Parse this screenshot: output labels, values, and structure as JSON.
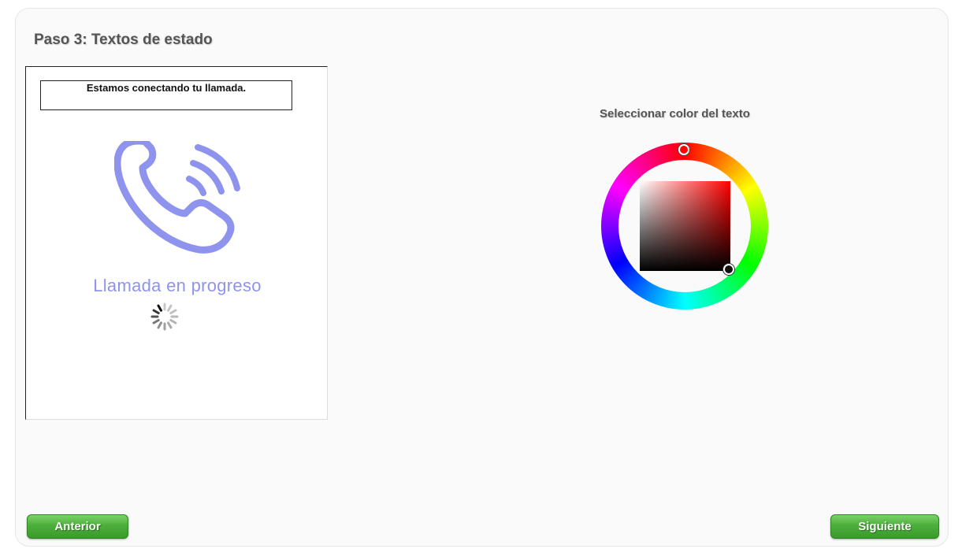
{
  "step_title": "Paso 3: Textos de estado",
  "preview": {
    "status_text": "Estamos conectando tu llamada.",
    "progress_text": "Llamada en progreso",
    "icon": "phone-calling-icon",
    "icon_color": "#8e93ee"
  },
  "color_picker": {
    "label": "Seleccionar color del texto",
    "selected_hue": "#ff0000",
    "selected_color": "#000000"
  },
  "nav": {
    "prev_label": "Anterior",
    "next_label": "Siguiente",
    "button_color": "#4cae3a"
  }
}
